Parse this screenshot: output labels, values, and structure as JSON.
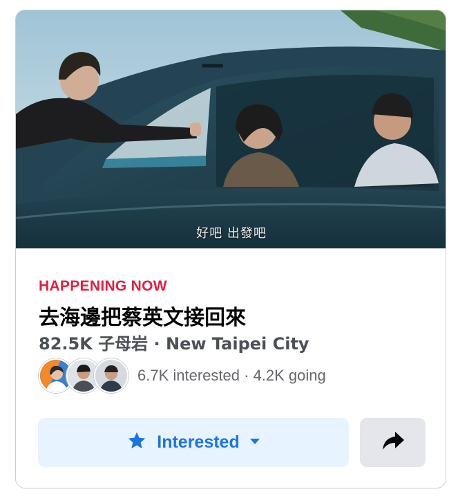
{
  "event": {
    "photo_subtitle": "好吧 出發吧",
    "status": "HAPPENING NOW",
    "title": "去海邊把蔡英文接回來",
    "location": "82.5K 子母岩 · New Taipei City",
    "stats": "6.7K interested · 4.2K going"
  },
  "actions": {
    "interested_label": "Interested",
    "interested_icon": "star-icon",
    "dropdown_icon": "caret-down-icon",
    "share_icon": "share-arrow-icon"
  },
  "colors": {
    "status": "#e41e3f",
    "accent": "#1b74e4",
    "interested_bg": "#e7f3ff",
    "share_bg": "#e4e6eb",
    "secondary_text": "#65676b"
  }
}
